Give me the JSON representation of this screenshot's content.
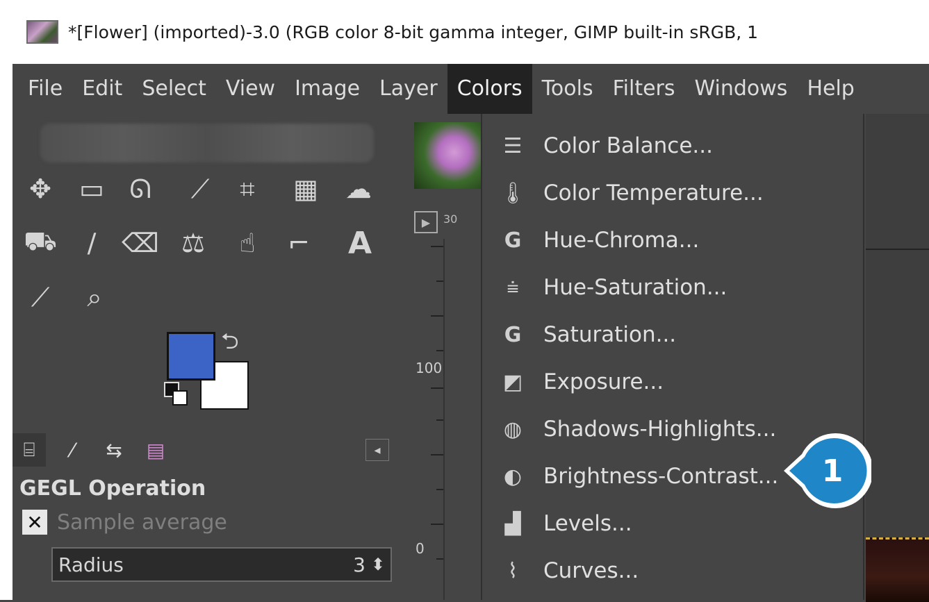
{
  "window": {
    "title": "*[Flower] (imported)-3.0 (RGB color 8-bit gamma integer, GIMP built-in sRGB, 1"
  },
  "menubar": [
    {
      "label": "File"
    },
    {
      "label": "Edit"
    },
    {
      "label": "Select"
    },
    {
      "label": "View"
    },
    {
      "label": "Image"
    },
    {
      "label": "Layer"
    },
    {
      "label": "Colors",
      "active": true
    },
    {
      "label": "Tools"
    },
    {
      "label": "Filters"
    },
    {
      "label": "Windows"
    },
    {
      "label": "Help"
    }
  ],
  "colors_menu": [
    {
      "label": "Color Balance...",
      "icon": "color-balance-icon"
    },
    {
      "label": "Color Temperature...",
      "icon": "color-temperature-icon"
    },
    {
      "label": "Hue-Chroma...",
      "icon": "gegl-g-icon"
    },
    {
      "label": "Hue-Saturation...",
      "icon": "hue-saturation-icon"
    },
    {
      "label": "Saturation...",
      "icon": "gegl-g-icon"
    },
    {
      "label": "Exposure...",
      "icon": "exposure-icon"
    },
    {
      "label": "Shadows-Highlights...",
      "icon": "shadows-highlights-icon"
    },
    {
      "label": "Brightness-Contrast...",
      "icon": "brightness-contrast-icon"
    },
    {
      "label": "Levels...",
      "icon": "levels-icon"
    },
    {
      "label": "Curves...",
      "icon": "curves-icon"
    }
  ],
  "tool_options": {
    "title": "GEGL Operation",
    "sample_average_label": "Sample average",
    "sample_average_checked": true,
    "radius_label": "Radius",
    "radius_value": "3"
  },
  "ruler": {
    "label_100": "100",
    "label_0": "0",
    "top_label": "30"
  },
  "callout": {
    "number": "1",
    "color": "#1f86c7"
  },
  "colors": {
    "foreground": "#3c63c6",
    "background": "#ffffff"
  }
}
